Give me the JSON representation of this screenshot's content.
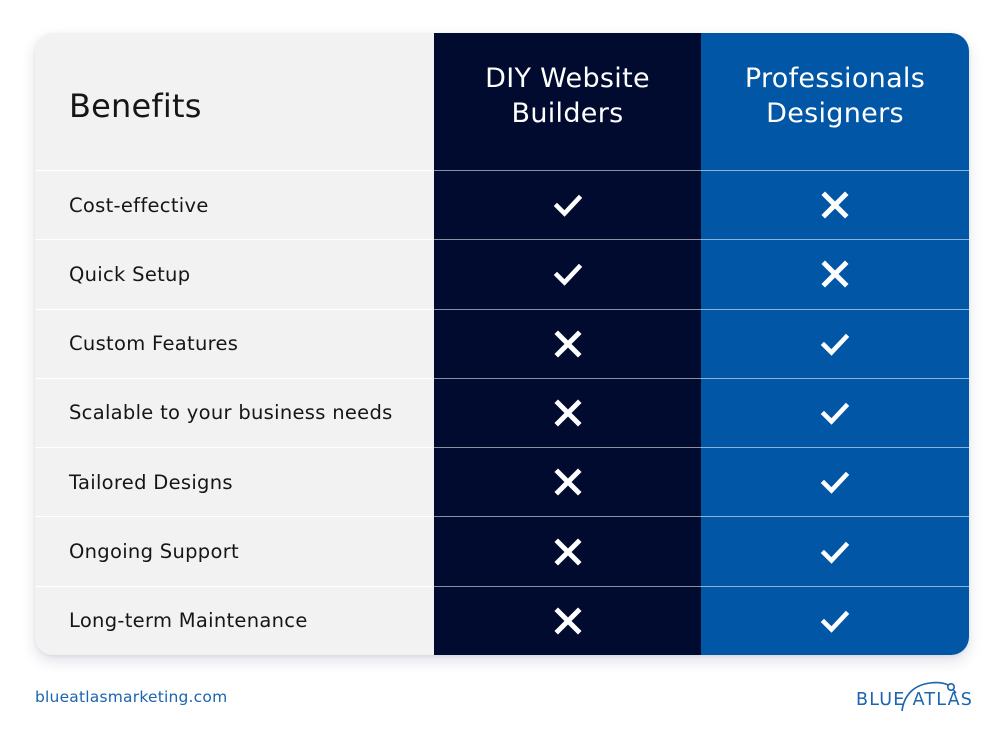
{
  "table": {
    "header": {
      "benefits_label": "Benefits",
      "columns": [
        {
          "line1": "DIY Website",
          "line2": "Builders"
        },
        {
          "line1": "Professionals",
          "line2": "Designers"
        }
      ]
    },
    "rows": [
      {
        "label": "Cost-effective",
        "diy": "check-icon",
        "pro": "x-icon"
      },
      {
        "label": "Quick Setup",
        "diy": "check-icon",
        "pro": "x-icon"
      },
      {
        "label": "Custom Features",
        "diy": "x-icon",
        "pro": "check-icon"
      },
      {
        "label": "Scalable to your business needs",
        "diy": "x-icon",
        "pro": "check-icon"
      },
      {
        "label": "Tailored Designs",
        "diy": "x-icon",
        "pro": "check-icon"
      },
      {
        "label": "Ongoing Support",
        "diy": "x-icon",
        "pro": "check-icon"
      },
      {
        "label": "Long-term Maintenance",
        "diy": "x-icon",
        "pro": "check-icon"
      }
    ]
  },
  "colors": {
    "benefits_column": "#f2f2f2",
    "diy_column": "#000b2f",
    "pro_column": "#0156a6",
    "brand_blue": "#1a64b0"
  },
  "footer": {
    "url": "blueatlasmarketing.com",
    "logo_text_left": "BLUE",
    "logo_text_right": "ATLAS"
  }
}
